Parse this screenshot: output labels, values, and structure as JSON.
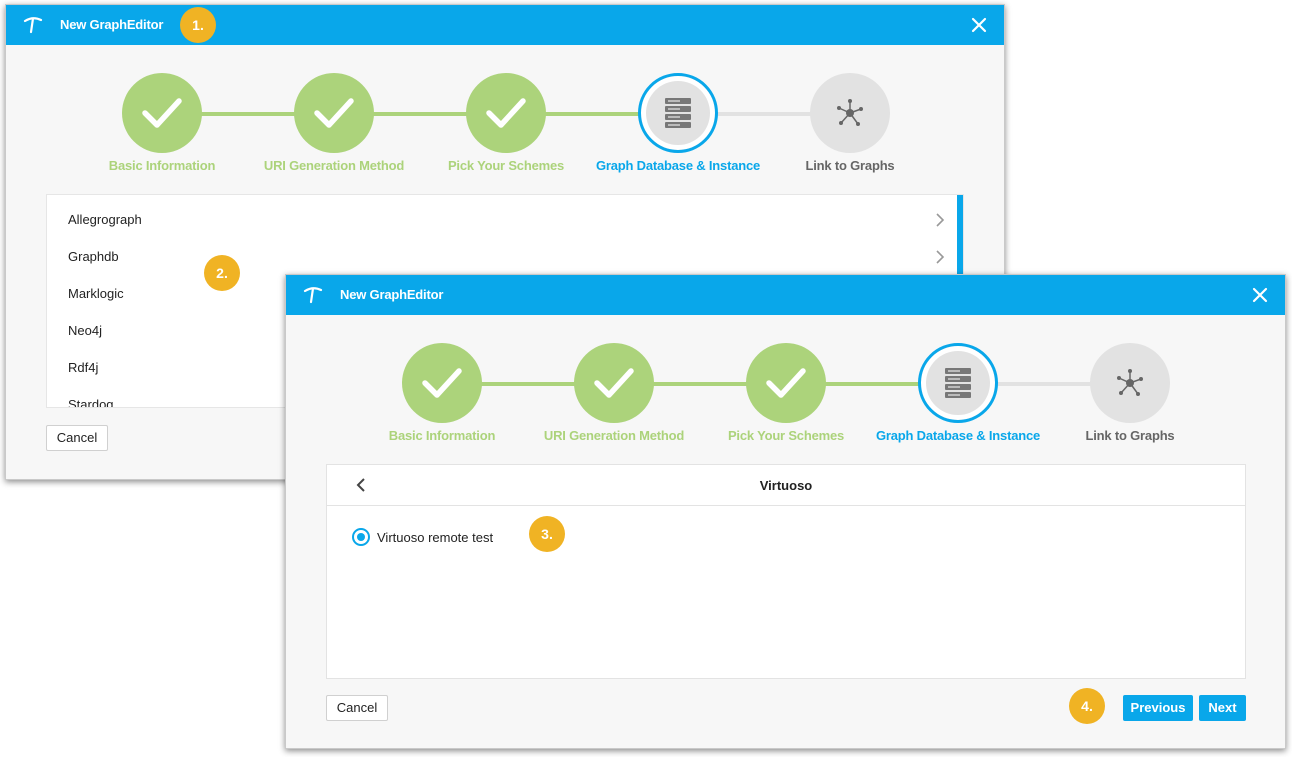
{
  "dialog1": {
    "title": "New GraphEditor",
    "steps": [
      {
        "label": "Basic Information",
        "state": "done"
      },
      {
        "label": "URI Generation Method",
        "state": "done"
      },
      {
        "label": "Pick Your Schemes",
        "state": "done"
      },
      {
        "label": "Graph Database & Instance",
        "state": "active"
      },
      {
        "label": "Link to Graphs",
        "state": "todo"
      }
    ],
    "databases": [
      {
        "label": "Allegrograph"
      },
      {
        "label": "Graphdb"
      },
      {
        "label": "Marklogic"
      },
      {
        "label": "Neo4j"
      },
      {
        "label": "Rdf4j"
      },
      {
        "label": "Stardog"
      }
    ],
    "cancel_label": "Cancel"
  },
  "dialog2": {
    "title": "New GraphEditor",
    "steps": [
      {
        "label": "Basic Information",
        "state": "done"
      },
      {
        "label": "URI Generation Method",
        "state": "done"
      },
      {
        "label": "Pick Your Schemes",
        "state": "done"
      },
      {
        "label": "Graph Database & Instance",
        "state": "active"
      },
      {
        "label": "Link to Graphs",
        "state": "todo"
      }
    ],
    "panel_title": "Virtuoso",
    "instance_label": "Virtuoso remote test",
    "cancel_label": "Cancel",
    "previous_label": "Previous",
    "next_label": "Next"
  },
  "badges": [
    "1.",
    "2.",
    "3.",
    "4."
  ],
  "colors": {
    "accent": "#09a7ea",
    "done": "#acd37b",
    "todo": "#e2e2e2",
    "badge": "#f0b324"
  }
}
